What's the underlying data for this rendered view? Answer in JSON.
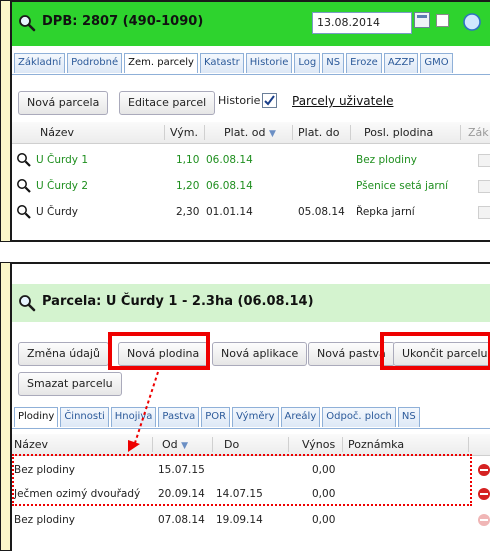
{
  "top_panel": {
    "title": "DPB: 2807 (490-1090)",
    "date": "13.08.2014",
    "tabs": [
      "Základní",
      "Podrobné",
      "Zem. parcely",
      "Katastr",
      "Historie",
      "Log",
      "NS",
      "Eroze",
      "AZZP",
      "GMO"
    ],
    "active_tab": "Zem. parcely",
    "buttons": {
      "new_parcel": "Nová parcela",
      "edit_parcels": "Editace parcel"
    },
    "history_label": "Historie",
    "user_parcels_link": "Parcely uživatele",
    "columns": [
      "Název",
      "Vým.",
      "Plat. od",
      "Plat. do",
      "Posl. plodina",
      "Zák"
    ],
    "rows": [
      {
        "name": "U Čurdy 1",
        "area": "1,10",
        "from": "06.08.14",
        "to": "",
        "crop": "Bez plodiny",
        "green": true
      },
      {
        "name": "U Čurdy 2",
        "area": "1,20",
        "from": "06.08.14",
        "to": "",
        "crop": "Pšenice setá jarní",
        "green": true
      },
      {
        "name": "U Čurdy",
        "area": "2,30",
        "from": "01.01.14",
        "to": "05.08.14",
        "crop": "Řepka jarní",
        "green": false
      }
    ]
  },
  "bottom_panel": {
    "title": "Parcela: U Čurdy 1 - 2.3ha (06.08.14)",
    "buttons": {
      "change_data": "Změna údajů",
      "new_crop": "Nová plodina",
      "new_application": "Nová aplikace",
      "new_pasture": "Nová pastva",
      "end_parcel": "Ukončit parcelu",
      "delete_parcel": "Smazat parcelu"
    },
    "tabs": [
      "Plodiny",
      "Činnosti",
      "Hnojiva",
      "Pastva",
      "POR",
      "Výměry",
      "Areály",
      "Odpoč. ploch",
      "NS"
    ],
    "active_tab": "Plodiny",
    "columns": [
      "Název",
      "Od",
      "Do",
      "Výnos",
      "Poznámka"
    ],
    "rows": [
      {
        "name": "Bez plodiny",
        "from": "15.07.15",
        "to": "",
        "yield": "0,00",
        "note": ""
      },
      {
        "name": "Ječmen ozimý dvouřadý",
        "from": "20.09.14",
        "to": "14.07.15",
        "yield": "0,00",
        "note": ""
      },
      {
        "name": "Bez plodiny",
        "from": "07.08.14",
        "to": "19.09.14",
        "yield": "0,00",
        "note": ""
      }
    ]
  },
  "colors": {
    "header_green": "#2ed32e",
    "title_green_light": "#d4f3cf",
    "highlight_red": "#ee0000",
    "side_yellow": "#fbf7c9"
  }
}
